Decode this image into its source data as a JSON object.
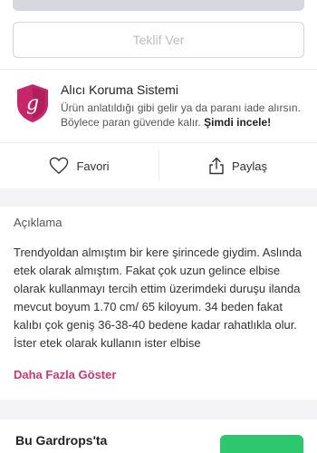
{
  "offer_button": {
    "label": "Teklif Ver"
  },
  "buyer_protection": {
    "title": "Alıcı Koruma Sistemi",
    "text": "Ürün anlatıldığı gibi gelir ya da paranı iade alırsın. Böylece paran güvende kalır.",
    "link": "Şimdi incele!",
    "shield_letter": "g",
    "shield_icon": "shield-g-icon",
    "shield_color": "#c8266a"
  },
  "actions": {
    "favorite_label": "Favori",
    "share_label": "Paylaş",
    "favorite_icon": "heart-icon",
    "share_icon": "share-icon"
  },
  "description": {
    "label": "Açıklama",
    "text": "Trendyoldan almıştım bir kere şirincede giydim. Aslında etek olarak almıştım. Fakat çok uzun gelince elbise olarak kullanmayı tercih ettim üzerimdeki duruşu ilanda mevcut boyum 1.70 cm/ 65 kiloyum. 34 beden fakat kalıbı çok geniş 36-38-40 bedene kadar rahatlıkla olur. İster etek olarak kullanın ister elbise",
    "more_link": "Daha Fazla Göster"
  },
  "wardrobe": {
    "title": "Bu Gardrops'ta"
  },
  "colors": {
    "accent": "#d7336f",
    "green": "#2dc76d"
  }
}
